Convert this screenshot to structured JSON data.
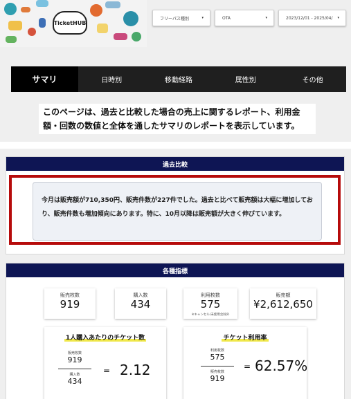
{
  "logo": {
    "text": "TicketHUB"
  },
  "filters": [
    {
      "label": "フリーパス種別",
      "caret": "▾"
    },
    {
      "label": "OTA",
      "caret": "▾"
    },
    {
      "label": "2023/12/01 - 2025/04/",
      "caret": "▾"
    }
  ],
  "nav": {
    "tabs": [
      "サマリ",
      "日時別",
      "移動経路",
      "属性別",
      "その他"
    ],
    "active": 0
  },
  "description": "このページは、過去と比較した場合の売上に関するレポート、利用金額・回数の数値と全体を通したサマリのレポートを表示しています。",
  "past": {
    "header": "過去比較",
    "summary": "今月は販売額が710,350円、販売件数が227件でした。過去と比べて販売額は大幅に増加しており、販売件数も増加傾向にあります。特に、10月以降は販売額が大きく伸びています。"
  },
  "metrics": {
    "header": "各種指標",
    "cards": [
      {
        "label": "販売枚数",
        "value": "919"
      },
      {
        "label": "購入数",
        "value": "434"
      },
      {
        "label": "利用枚数",
        "value": "575",
        "note": "※キャンセル/未使用含除外"
      },
      {
        "label": "販売額",
        "value": "¥2,612,650"
      }
    ],
    "per_person": {
      "title": "1人購入あたりのチケット数",
      "num_label": "販売枚数",
      "num_value": "919",
      "den_label": "購入数",
      "den_value": "434",
      "eq": "=",
      "result": "2.12"
    },
    "usage": {
      "title": "チケット利用率",
      "num_label": "利用枚数",
      "num_value": "575",
      "den_label": "販売枚数",
      "den_value": "919",
      "eq": "=",
      "result": "62.57%"
    }
  },
  "colors": {
    "navy": "#0e1554",
    "nav_bg": "#1f1f1f",
    "red_border": "#b60b0b",
    "highlight": "#f0e84a"
  }
}
